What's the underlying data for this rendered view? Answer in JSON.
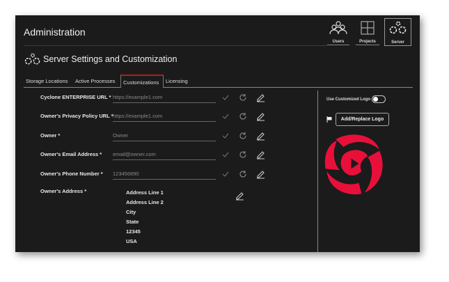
{
  "header": {
    "title": "Administration"
  },
  "nav": [
    {
      "label": "Users",
      "icon": "users-icon"
    },
    {
      "label": "Projects",
      "icon": "grid-icon"
    },
    {
      "label": "Server",
      "icon": "gears-icon",
      "active": true
    }
  ],
  "section": {
    "title": "Server Settings and Customization"
  },
  "tabs": [
    {
      "label": "Storage Locations"
    },
    {
      "label": "Active Processes"
    },
    {
      "label": "Customizations",
      "active": true
    },
    {
      "label": "Licensing"
    }
  ],
  "fields": [
    {
      "label": "Cyclone ENTERPRISE URL *",
      "placeholder": "https://example1.com"
    },
    {
      "label": "Owner's Privacy Policy URL *",
      "placeholder": "https://example1.com"
    },
    {
      "label": "Owner *",
      "placeholder": "Owner"
    },
    {
      "label": "Owner's Email Address *",
      "placeholder": "email@owner.com"
    },
    {
      "label": "Owner's Phone Number *",
      "placeholder": "123456890"
    }
  ],
  "address": {
    "label": "Owner's Address *",
    "lines": [
      "Address Line 1",
      "Address Line 2",
      "City",
      "State",
      "12345",
      "USA"
    ]
  },
  "logo": {
    "toggle_label": "Use Customized Logo",
    "toggle_on": false,
    "button_label": "Add/Replace Logo",
    "color": "#e8103a"
  }
}
